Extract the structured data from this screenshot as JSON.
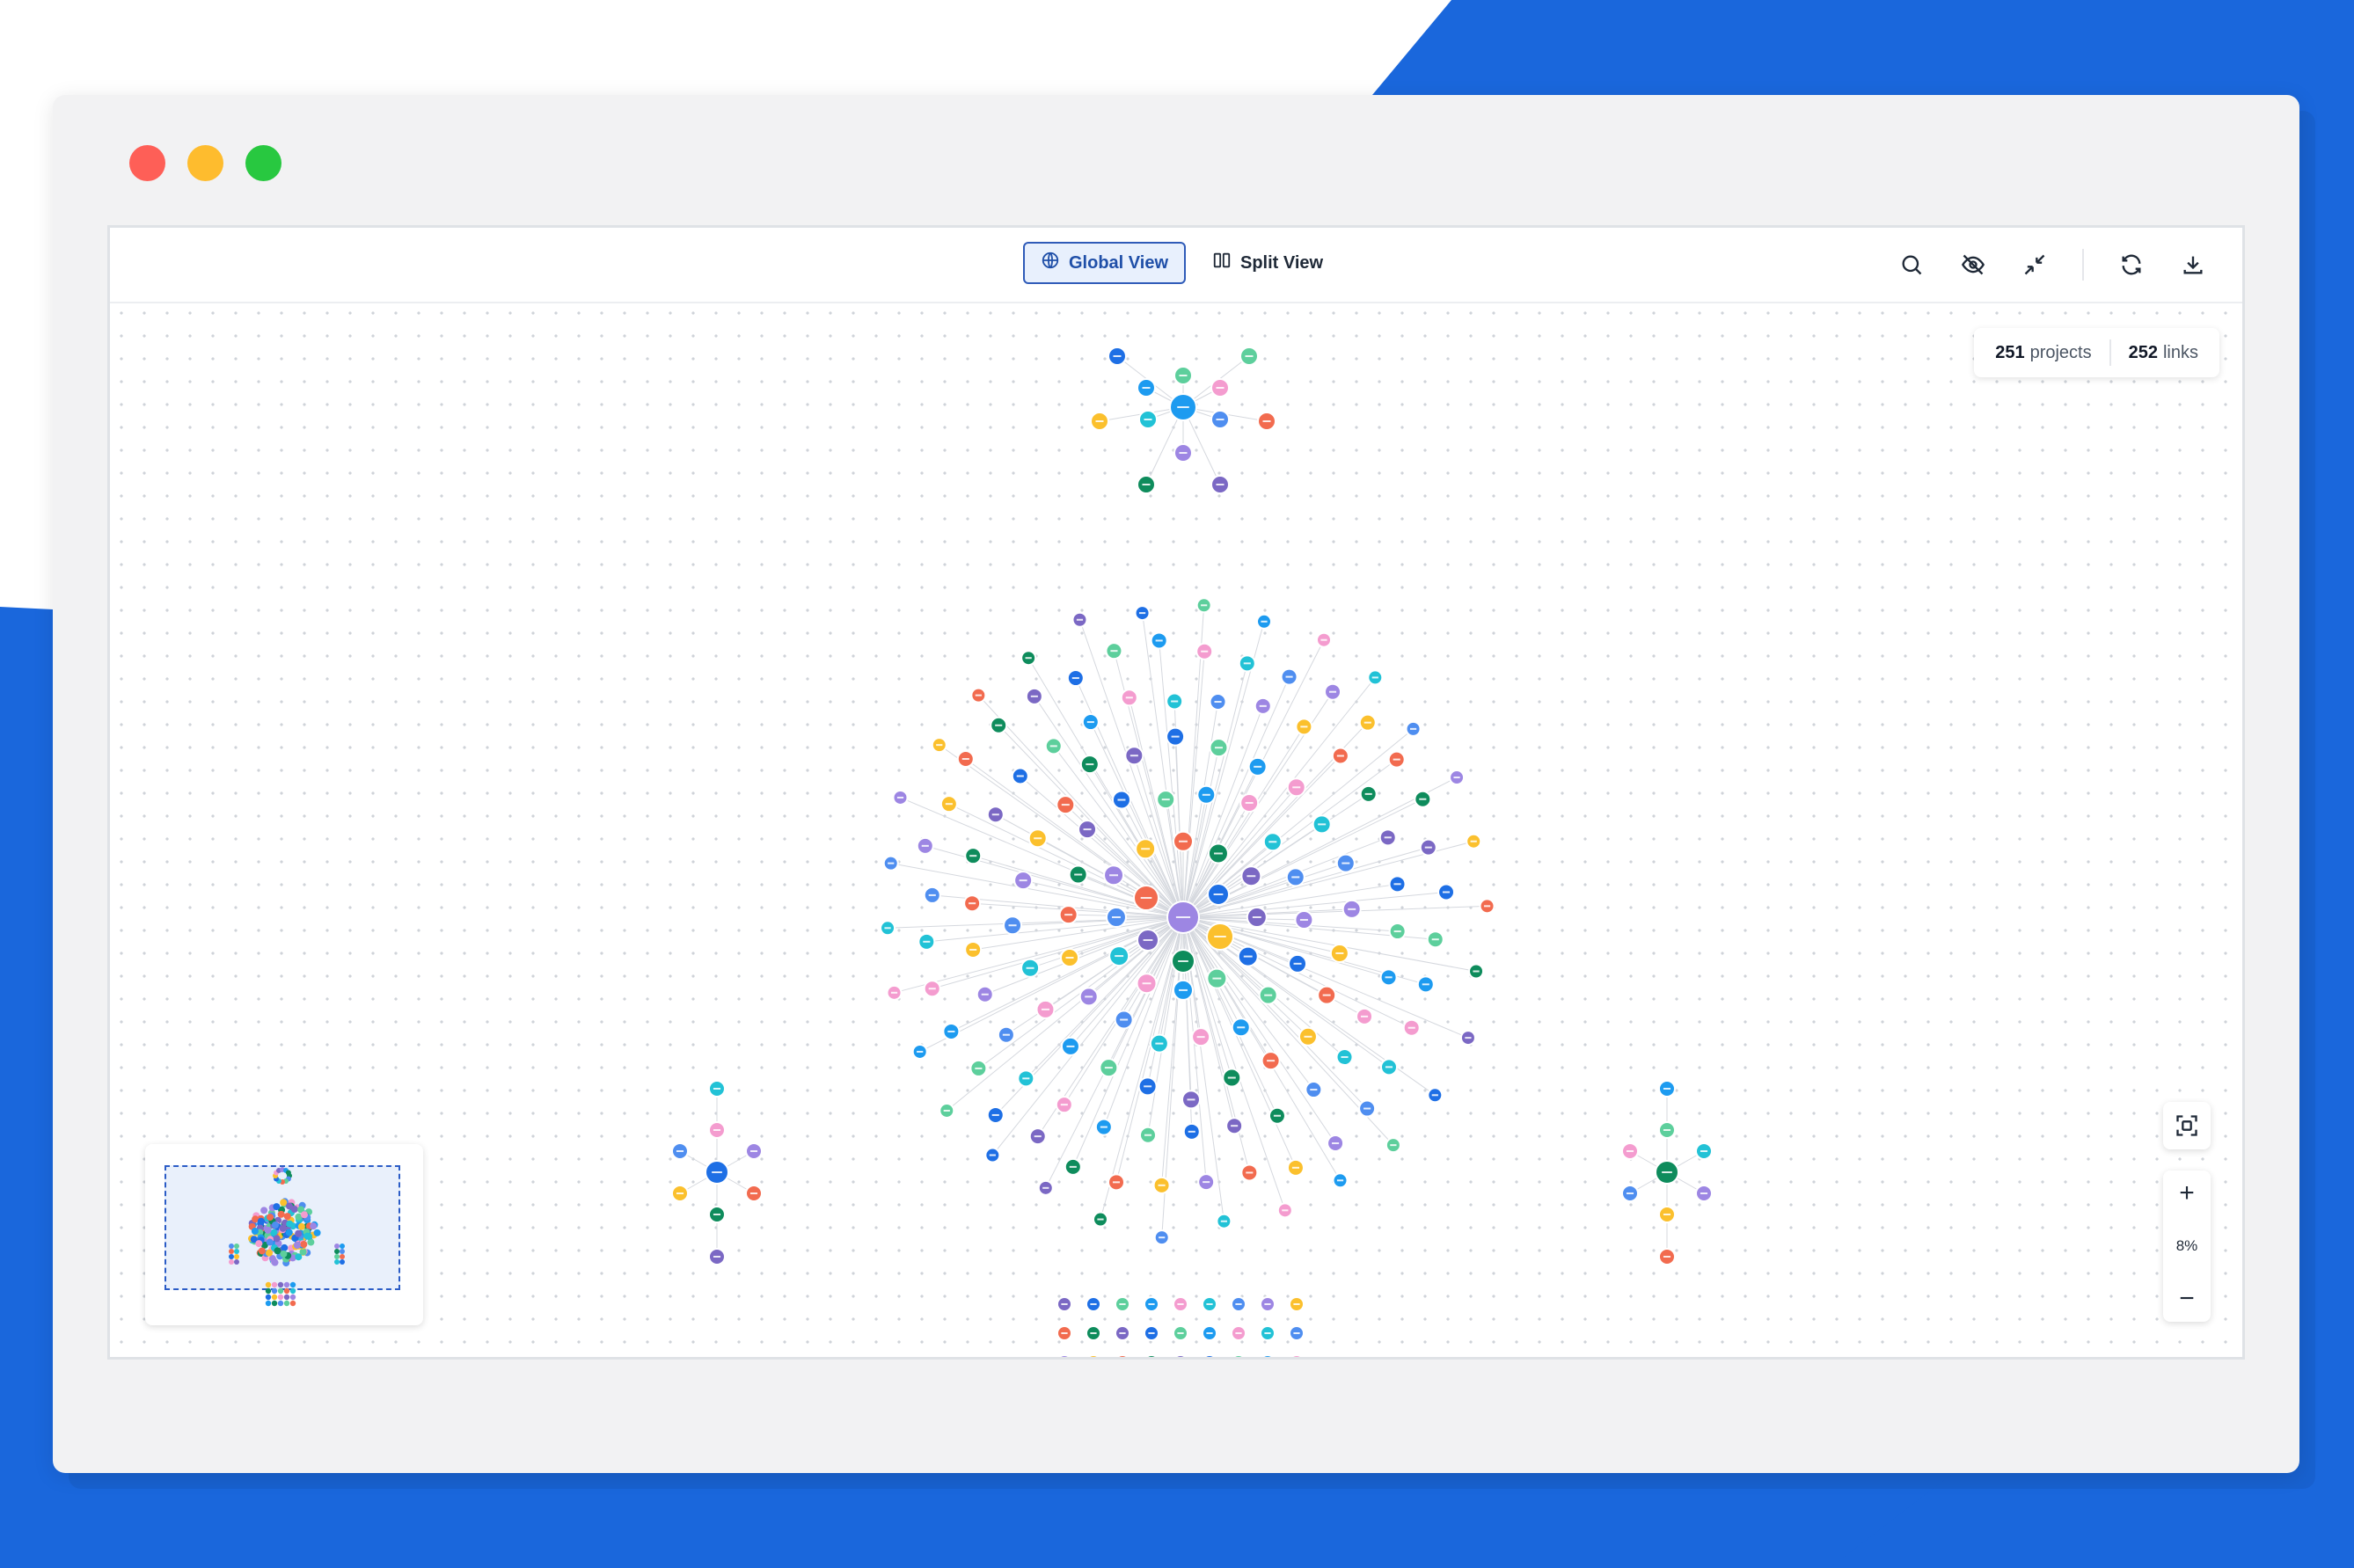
{
  "toolbar": {
    "views": [
      {
        "label": "Global View",
        "icon": "globe-icon",
        "active": true
      },
      {
        "label": "Split View",
        "icon": "columns-icon",
        "active": false
      }
    ],
    "tools": [
      "search-icon",
      "eye-off-icon",
      "collapse-icon",
      "refresh-icon",
      "download-icon"
    ]
  },
  "stats": {
    "projects_count": "251",
    "projects_label": "projects",
    "links_count": "252",
    "links_label": "links"
  },
  "zoom": {
    "in": "+",
    "level": "8%",
    "out": "−"
  },
  "colors": {
    "brand_blue": "#1a67dc",
    "accent": "#2f5bb8",
    "palette": [
      "#f26b4f",
      "#4f8ef0",
      "#1d9bf0",
      "#7b68c4",
      "#fbc02d",
      "#22c2d6",
      "#5dcf9c",
      "#0e8c5c",
      "#9d86e3",
      "#f49ccf",
      "#1e6fe5"
    ]
  }
}
